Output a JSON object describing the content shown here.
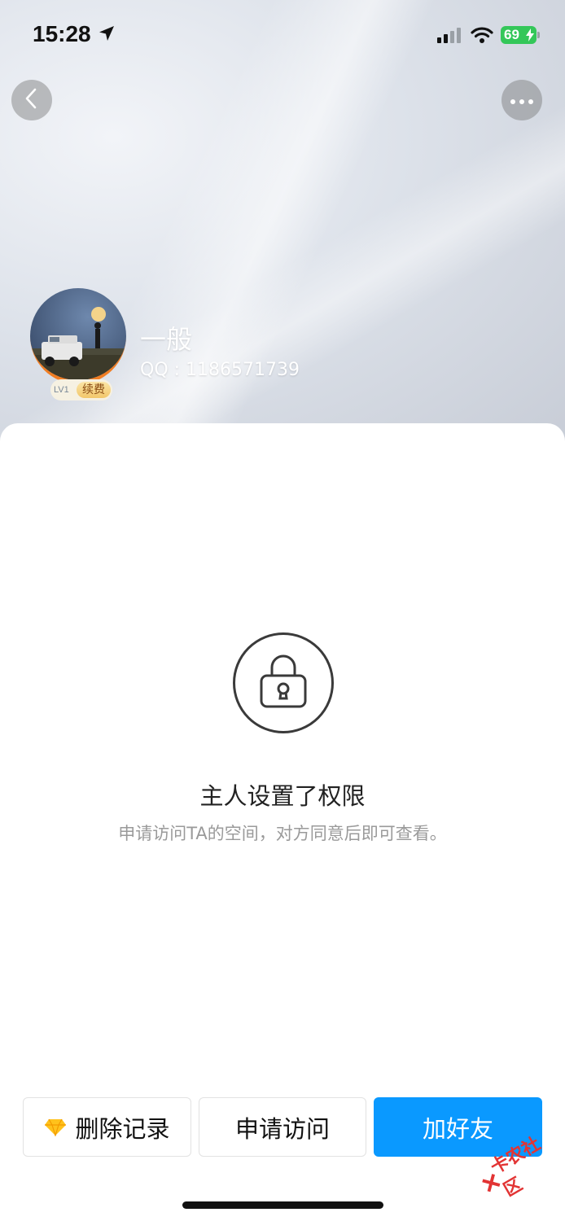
{
  "status_bar": {
    "time": "15:28",
    "battery": "69",
    "location_icon": "location-arrow-icon",
    "signal_icon": "cellular-signal-icon",
    "wifi_icon": "wifi-icon",
    "battery_color": "#34c759"
  },
  "nav": {
    "back_icon": "chevron-left-icon",
    "more_icon": "more-dots-icon"
  },
  "profile": {
    "name": "一般",
    "qq": "QQ : 1186571739",
    "level": "LV1",
    "renew_label": "续费"
  },
  "permission": {
    "icon": "lock-icon",
    "title": "主人设置了权限",
    "description": "申请访问TA的空间，对方同意后即可查看。"
  },
  "actions": {
    "delete_label": "删除记录",
    "apply_label": "申请访问",
    "add_friend_label": "加好友",
    "accent_color": "#0a99ff"
  },
  "watermark": {
    "text": "卡农社区"
  }
}
